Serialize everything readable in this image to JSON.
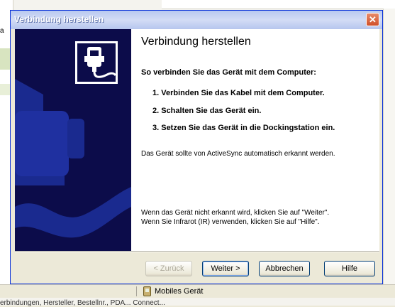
{
  "window": {
    "title": "Verbindung herstellen",
    "close_icon": "close-icon"
  },
  "content": {
    "heading": "Verbindung herstellen",
    "subheading": "So verbinden Sie das Gerät mit dem Computer:",
    "steps": [
      "1. Verbinden Sie das Kabel mit dem Computer.",
      "2. Schalten Sie das Gerät ein.",
      "3. Setzen Sie das Gerät in die Dockingstation ein."
    ],
    "auto_note": "Das Gerät sollte von ActiveSync automatisch erkannt werden.",
    "help_line1": "Wenn das Gerät nicht erkannt wird, klicken Sie auf \"Weiter\".",
    "help_line2": "Wenn Sie Infrarot (IR) verwenden, klicken Sie auf \"Hilfe\"."
  },
  "buttons": {
    "back": "< Zurück",
    "next": "Weiter >",
    "cancel": "Abbrechen",
    "help": "Hilfe"
  },
  "statusbar": {
    "device": "Mobiles Gerät",
    "device_icon": "mobile-device-icon"
  },
  "background": {
    "left_label": "a",
    "bottom_text": "erbindungen, Hersteller, Bestellnr., PDA... Connect..."
  },
  "colors": {
    "banner": "#0c0c4a",
    "banner_shape": "#1a2a8f",
    "accent_border": "#0831d9"
  }
}
